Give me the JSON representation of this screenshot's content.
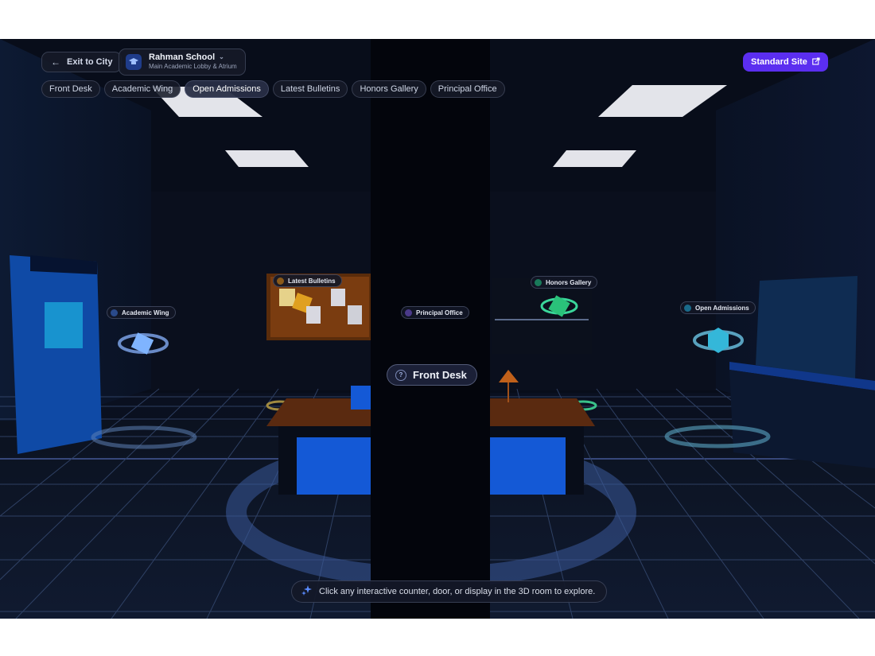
{
  "header": {
    "exit_label": "Exit to City",
    "school_name": "Rahman School",
    "school_location": "Main Academic Lobby & Atrium",
    "standard_site_label": "Standard Site"
  },
  "tabs": [
    "Front Desk",
    "Academic Wing",
    "Open Admissions",
    "Latest Bulletins",
    "Honors Gallery",
    "Principal Office"
  ],
  "active_tab": "Open Admissions",
  "hotspots": {
    "academic_wing": "Academic Wing",
    "latest_bulletins": "Latest Bulletins",
    "principal_office": "Principal Office",
    "honors_gallery": "Honors Gallery",
    "open_admissions": "Open Admissions",
    "front_desk": "Front Desk"
  },
  "hint_text": "Click any interactive counter, door, or display in the 3D room to explore.",
  "colors": {
    "accent_purple": "#5b2ef0",
    "desk_blue": "#1459d6",
    "board_orange": "#c06f1a",
    "gallery_green": "#22c27a",
    "admissions_cyan": "#34b7d9"
  },
  "icons": {
    "exit": "arrow-left-icon",
    "school": "graduation-cap-icon",
    "school_menu": "chevron-down-icon",
    "external": "external-link-icon",
    "hint": "sparkles-icon",
    "front_desk": "question-circle-icon"
  }
}
